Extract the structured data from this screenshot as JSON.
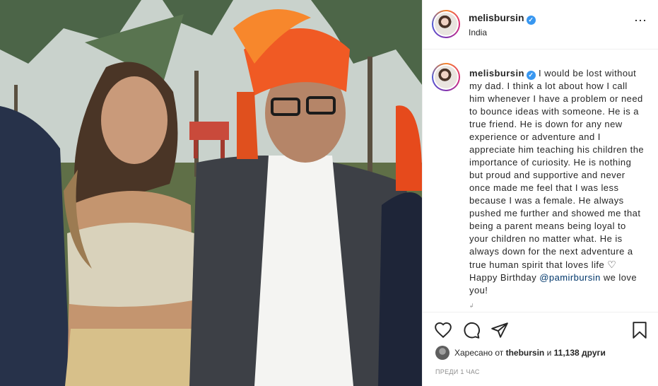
{
  "post": {
    "username": "melisbursin",
    "verified_glyph": "✓",
    "location": "India",
    "more_icon": "⋯",
    "caption_before_mention": "I would be lost without my dad. I think a lot about how I call him whenever I have a problem or need to bounce ideas with someone. He is a true friend. He is down for any new experience or adventure and I appreciate him teaching his children the importance of curiosity. He is nothing but proud and supportive and never once made me feel that I was less because I was a female. He always pushed me further and showed me that being a parent means being loyal to your children no matter what. He is always down for the next adventure a true human spirit that loves life",
    "caption_heart": "♡",
    "caption_birthday": "Happy Birthday",
    "caption_mention": "@pamirbursin",
    "caption_after_mention": "we love you!",
    "caption_tail": "↲"
  },
  "actions": {
    "like_icon": "heart-icon",
    "comment_icon": "comment-icon",
    "share_icon": "share-icon",
    "save_icon": "bookmark-icon"
  },
  "likes": {
    "prefix": "Харесано от",
    "user": "thebursin",
    "conjunction": "и",
    "count": "11,138 други"
  },
  "timestamp": "преди 1 час",
  "colors": {
    "link": "#00376b",
    "verified": "#3897f0",
    "muted": "#8e8e8e",
    "divider": "#efefef"
  }
}
